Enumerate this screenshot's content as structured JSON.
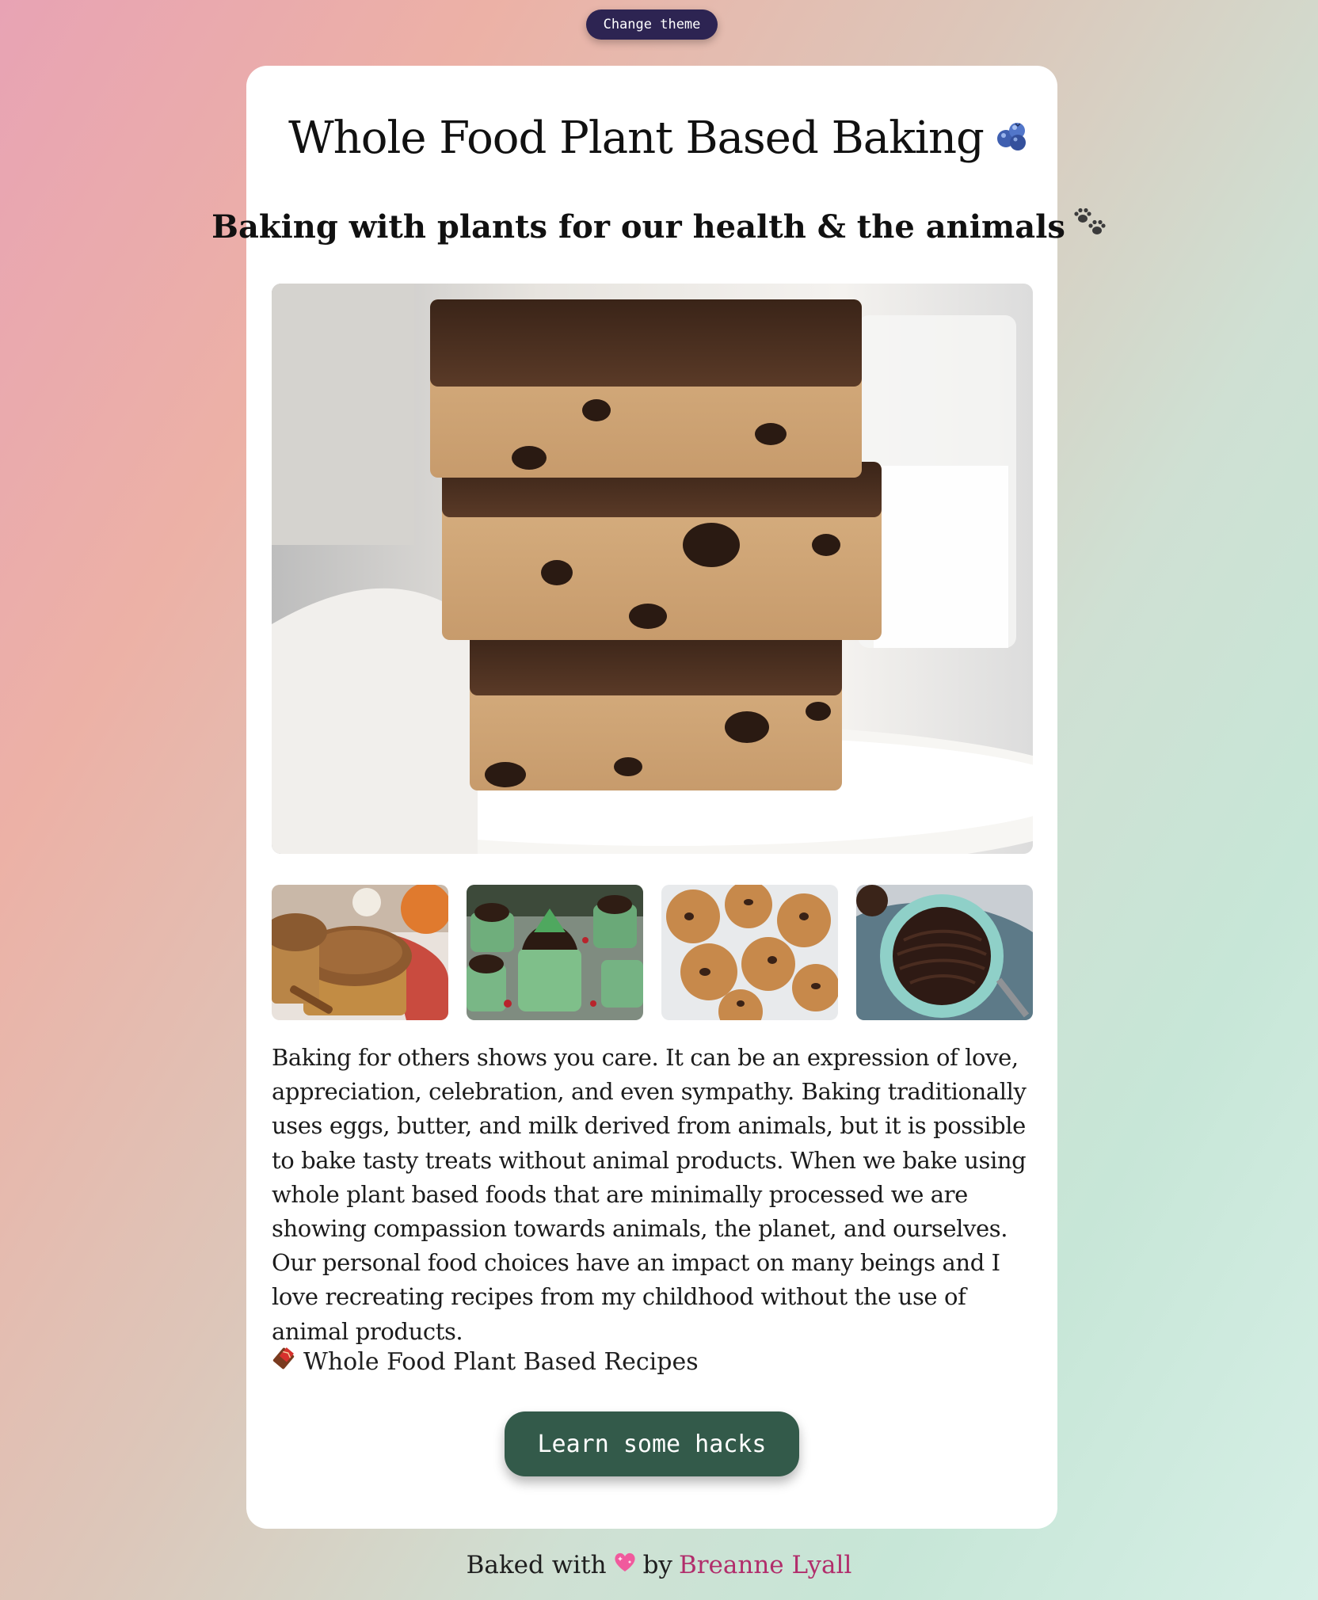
{
  "header": {
    "theme_button_label": "Change theme"
  },
  "card": {
    "title": "Whole Food Plant Based Baking",
    "title_icon": "blueberries-icon",
    "subtitle": "Baking with plants for our health & the animals",
    "subtitle_icon": "paw-prints-icon",
    "hero_image": "stacked-chocolate-chip-cookie-dough-bars",
    "thumbnails": [
      "pumpkin-muffins",
      "mint-chocolate-cups",
      "chocolate-chip-cookies",
      "chocolate-tart"
    ],
    "body": "Baking for others shows you care. It can be an expression of love, appreciation, celebration, and even sympathy. Baking traditionally uses eggs, butter, and milk derived from animals, but it is possible to bake tasty treats without animal products. When we bake using whole plant based foods that are minimally processed we are showing compassion towards animals, the planet, and ourselves. Our personal food choices have an impact on many beings and I love recreating recipes from my childhood without the use of animal products.",
    "recipes_link": "Whole Food Plant Based Recipes",
    "recipes_icon": "chocolate-bar-icon",
    "hacks_button_label": "Learn some hacks"
  },
  "footer": {
    "prefix": "Baked with",
    "heart_icon": "sparkling-heart-icon",
    "by": "by",
    "author": "Breanne Lyall",
    "author_color": "#b12d6b"
  },
  "colors": {
    "theme_button_bg": "#2d2452",
    "hacks_button_bg": "#335a4a",
    "card_bg": "#ffffff"
  }
}
